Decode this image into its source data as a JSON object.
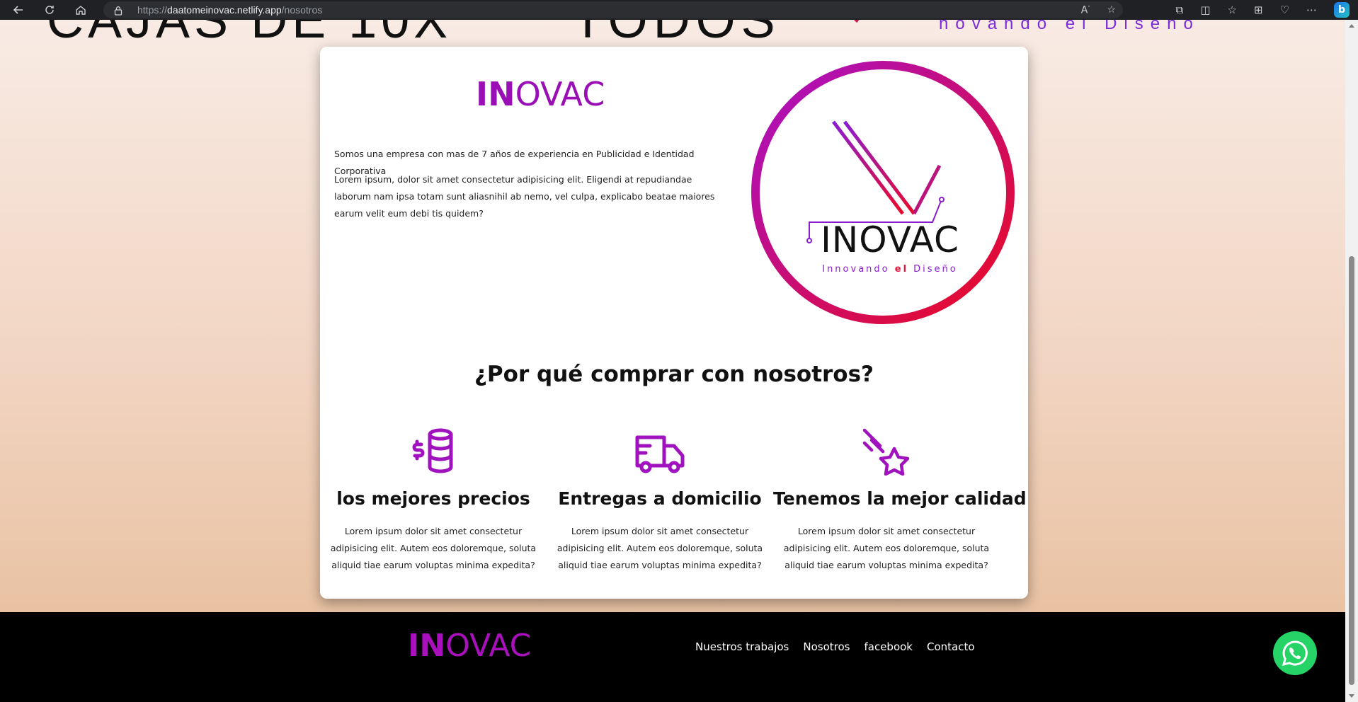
{
  "browser": {
    "url_prefix": "https://",
    "url_host": "daatomeinovac.netlify.app",
    "url_path": "/nosotros"
  },
  "about": {
    "brand_in": "IN",
    "brand_ovac": "OVAC",
    "intro": "Somos una empresa con mas de 7 años de experiencia en Publicidad e Identidad Corporativa",
    "body": "Lorem ipsum, dolor sit amet consectetur adipisicing elit. Eligendi at repudiandae laborum nam ipsa totam sunt aliasnihil ab nemo, vel culpa, explicabo beatae maiores earum velit eum debi tis quidem?",
    "logo_wordmark": "INOVAC",
    "logo_tagline_a": "Innovando ",
    "logo_tagline_b": "el",
    "logo_tagline_c": " Diseño"
  },
  "why": {
    "title": "¿Por qué comprar con nosotros?",
    "features": [
      {
        "icon": "coins-dollar-icon",
        "title": "los mejores precios",
        "desc": "Lorem ipsum dolor sit amet consectetur adipisicing elit. Autem eos doloremque, soluta aliquid tiae earum voluptas minima expedita?"
      },
      {
        "icon": "delivery-truck-icon",
        "title": "Entregas a domicilio",
        "desc": "Lorem ipsum dolor sit amet consectetur adipisicing elit. Autem eos doloremque, soluta aliquid tiae earum voluptas minima expedita?"
      },
      {
        "icon": "shooting-star-icon",
        "title": "Tenemos la mejor calidad",
        "desc": "Lorem ipsum dolor sit amet consectetur adipisicing elit. Autem eos doloremque, soluta aliquid tiae earum voluptas minima expedita?"
      }
    ]
  },
  "footer": {
    "brand_in": "IN",
    "brand_ovac": "OVAC",
    "links": [
      "Nuestros trabajos",
      "Nosotros",
      "facebook",
      "Contacto"
    ]
  },
  "colors": {
    "brand_purple": "#9a0fb5",
    "gradient_start": "#a811c7",
    "gradient_end": "#ea0a1f",
    "whatsapp_green": "#25d366"
  }
}
